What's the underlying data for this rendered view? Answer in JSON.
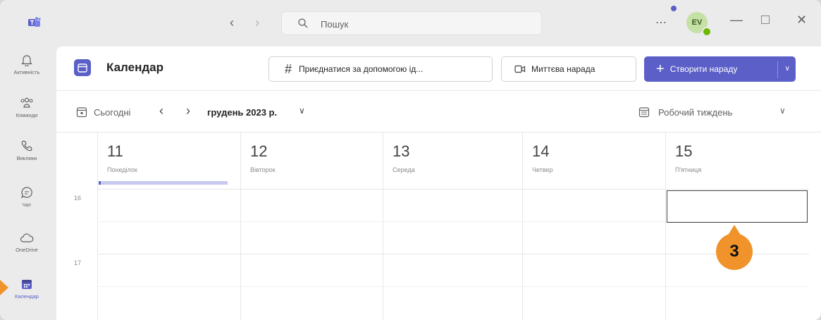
{
  "titlebar": {
    "search_placeholder": "Пошук",
    "avatar_initials": "EV"
  },
  "rail": {
    "items": [
      {
        "label": "Активність",
        "icon": "bell-icon"
      },
      {
        "label": "Команди",
        "icon": "teams-icon"
      },
      {
        "label": "Виклики",
        "icon": "phone-icon"
      },
      {
        "label": "Чат",
        "icon": "chat-icon"
      },
      {
        "label": "OneDrive",
        "icon": "cloud-icon"
      },
      {
        "label": "Календар",
        "icon": "calendar-icon",
        "active": true
      }
    ]
  },
  "header": {
    "title": "Календар",
    "join_label": "Приєднатися за допомогою ід...",
    "meet_now_label": "Миттєва нарада",
    "new_meeting_label": "Створити нараду"
  },
  "toolbar": {
    "today_label": "Сьогодні",
    "month_label": "грудень 2023 р.",
    "view_label": "Робочий тиждень"
  },
  "week": {
    "days": [
      {
        "num": "11",
        "name": "Понеділок"
      },
      {
        "num": "12",
        "name": "Вівторок"
      },
      {
        "num": "13",
        "name": "Середа"
      },
      {
        "num": "14",
        "name": "Четвер"
      },
      {
        "num": "15",
        "name": "П'ятниця"
      }
    ],
    "hours": [
      "16",
      "17"
    ]
  },
  "annotation": {
    "step": "3"
  },
  "colors": {
    "accent": "#5b5fc7",
    "callout": "#f0932b"
  }
}
